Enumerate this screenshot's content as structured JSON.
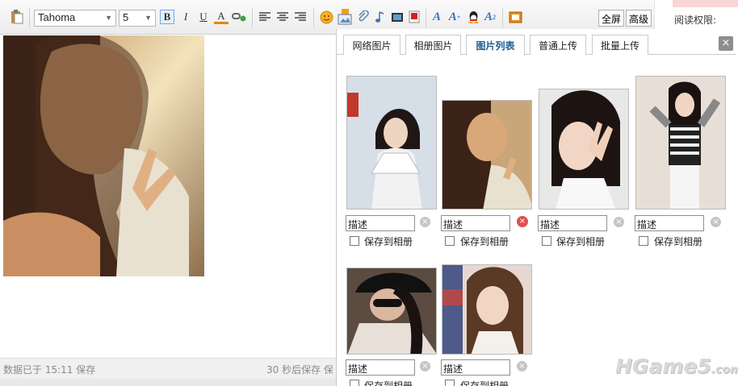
{
  "toolbar": {
    "font_name": "Tahoma",
    "font_size": "5",
    "bold_label": "B",
    "italic_label": "I",
    "underline_label": "U",
    "color_label": "A",
    "fullscreen_label": "全屏",
    "advanced_label": "高级"
  },
  "sidebar": {
    "permission_label": "阅读权限:"
  },
  "status": {
    "saved_text": "数据已于 15:11 保存",
    "autosave_text": "30 秒后保存 保"
  },
  "panel": {
    "tabs": [
      "网络图片",
      "相册图片",
      "图片列表",
      "普通上传",
      "批量上传"
    ],
    "active_tab": "图片列表",
    "close_label": "×",
    "images": [
      {
        "desc": "描述",
        "save_label": "保存到相册"
      },
      {
        "desc": "描述",
        "save_label": "保存到相册"
      },
      {
        "desc": "描述",
        "save_label": "保存到相册"
      },
      {
        "desc": "描述",
        "save_label": "保存到相册"
      },
      {
        "desc": "描述",
        "save_label": "保存到相册"
      },
      {
        "desc": "描述",
        "save_label": "保存到相册"
      }
    ]
  },
  "watermark": {
    "text": "HGame5",
    "suffix": ".com"
  },
  "colors": {
    "active_tab": "#1e5b8c",
    "delete_active": "#e05050"
  }
}
